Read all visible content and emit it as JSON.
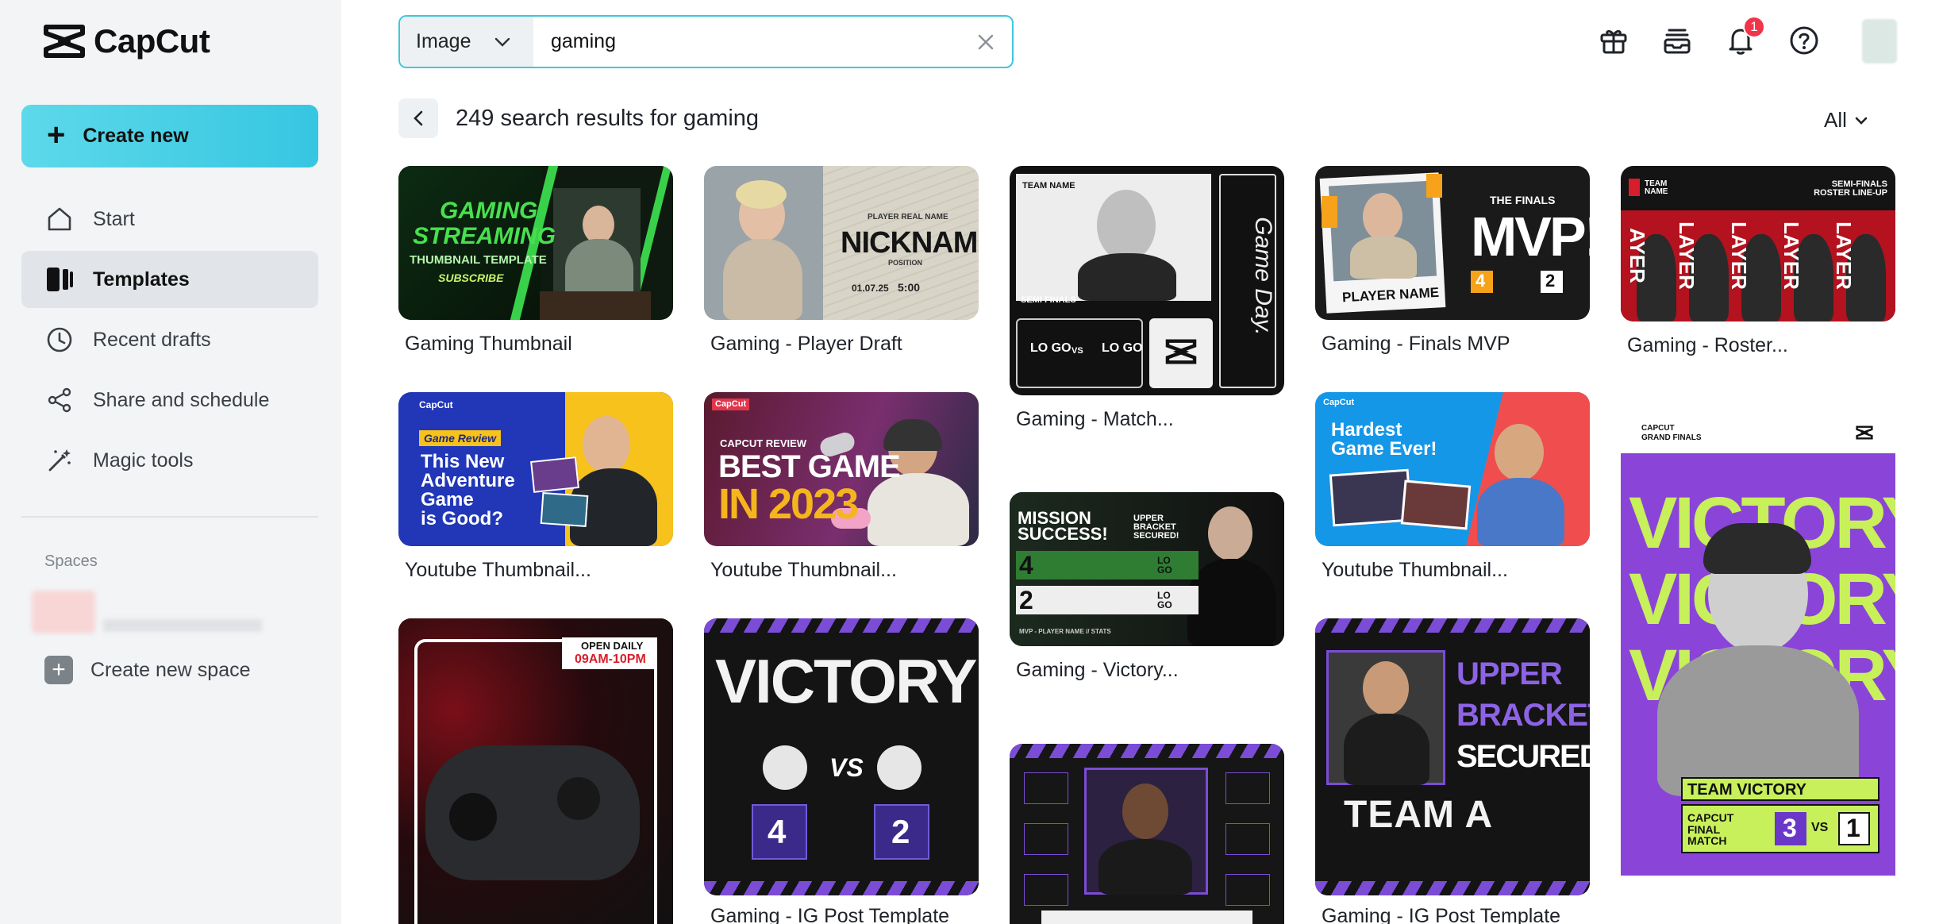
{
  "app": {
    "logo_text": "CapCut"
  },
  "sidebar": {
    "create_label": "Create new",
    "items": [
      {
        "label": "Start",
        "icon": "home-icon"
      },
      {
        "label": "Templates",
        "icon": "templates-icon",
        "active": true
      },
      {
        "label": "Recent drafts",
        "icon": "clock-icon"
      },
      {
        "label": "Share and schedule",
        "icon": "share-icon"
      },
      {
        "label": "Magic tools",
        "icon": "magic-wand-icon"
      }
    ],
    "spaces_label": "Spaces",
    "create_space_label": "Create new space"
  },
  "search": {
    "type_label": "Image",
    "value": "gaming"
  },
  "topbar": {
    "notification_count": "1",
    "icons": [
      "gift-icon",
      "inbox-stack-icon",
      "bell-icon",
      "help-icon"
    ]
  },
  "results": {
    "title": "249 search results for gaming",
    "filter_label": "All"
  },
  "cards": [
    {
      "title": "Gaming Thumbnail",
      "texts": [
        "GAMING",
        "STREAMING",
        "THUMBNAIL TEMPLATE",
        "SUBSCRIBE"
      ]
    },
    {
      "title": "Gaming - Player Draft",
      "texts": [
        "PLAYER REAL NAME",
        "NICKNAME",
        "POSITION",
        "01.07.25",
        "5:00"
      ]
    },
    {
      "title": "Gaming - Match...",
      "texts": [
        "TEAM NAME",
        "Game Day.",
        "SEMI FINALS",
        "LO GO",
        "VS",
        "LO GO"
      ]
    },
    {
      "title": "Gaming - Finals MVP",
      "texts": [
        "THE FINALS",
        "MVP!",
        "PLAYER NAME",
        "4",
        "2"
      ]
    },
    {
      "title": "Gaming - Roster...",
      "texts": [
        "TEAM NAME",
        "SEMI-FINALS ROSTER LINE-UP",
        "AYER",
        "LAYER",
        "LAYER",
        "LAYER",
        "LAYER"
      ]
    },
    {
      "title": "Youtube Thumbnail...",
      "texts": [
        "CapCut",
        "Game Review",
        "This New",
        "Adventure",
        "Game",
        "is Good?"
      ]
    },
    {
      "title": "Youtube Thumbnail...",
      "texts": [
        "CapCut",
        "CAPCUT REVIEW",
        "BEST GAME",
        "IN 2023"
      ]
    },
    {
      "title": "Gaming - Victory...",
      "texts": [
        "MISSION",
        "SUCCESS!",
        "UPPER BRACKET SECURED!",
        "4",
        "2",
        "LO GO",
        "LO GO",
        "MVP - PLAYER NAME // STATS"
      ]
    },
    {
      "title": "Youtube Thumbnail...",
      "texts": [
        "CapCut",
        "Hardest",
        "Game Ever!"
      ]
    },
    {
      "title": "",
      "texts": [
        "CAPCUT",
        "GRAND FINALS",
        "VICTORY!",
        "VICTORY!",
        "VICTORY!",
        "TEAM VICTORY",
        "CAPCUT FINAL MATCH",
        "3",
        "VS",
        "1"
      ]
    },
    {
      "title": "",
      "texts": [
        "OPEN DAILY",
        "09AM-10PM"
      ]
    },
    {
      "title": "Gaming - IG Post Template",
      "texts": [
        "VICTORY",
        "VS",
        "4",
        "2"
      ]
    },
    {
      "title": "",
      "texts": []
    },
    {
      "title": "Gaming - IG Post Template",
      "texts": [
        "UPPER",
        "BRACKET",
        "SECURED!",
        "TEAM A"
      ]
    }
  ]
}
